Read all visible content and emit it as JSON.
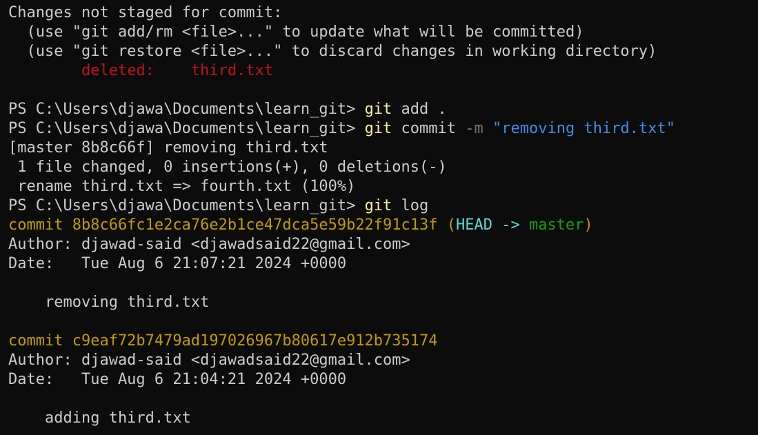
{
  "terminal": {
    "lines": [
      [
        {
          "t": "Changes not staged for commit:",
          "c": "default"
        }
      ],
      [
        {
          "t": "  (use \"git add/rm <file>...\" to update what will be committed)",
          "c": "default"
        }
      ],
      [
        {
          "t": "  (use \"git restore <file>...\" to discard changes in working directory)",
          "c": "default"
        }
      ],
      [
        {
          "t": "        ",
          "c": "default"
        },
        {
          "t": "deleted:    third.txt",
          "c": "red"
        }
      ],
      [
        {
          "t": "",
          "c": "default"
        }
      ],
      [
        {
          "t": "PS C:\\Users\\djawa\\Documents\\learn_git> ",
          "c": "default"
        },
        {
          "t": "git",
          "c": "yellow"
        },
        {
          "t": " add .",
          "c": "default"
        }
      ],
      [
        {
          "t": "PS C:\\Users\\djawa\\Documents\\learn_git> ",
          "c": "default"
        },
        {
          "t": "git",
          "c": "yellow"
        },
        {
          "t": " commit ",
          "c": "default"
        },
        {
          "t": "-m",
          "c": "gray"
        },
        {
          "t": " ",
          "c": "default"
        },
        {
          "t": "\"removing third.txt\"",
          "c": "blue"
        }
      ],
      [
        {
          "t": "[master 8b8c66f] removing third.txt",
          "c": "default"
        }
      ],
      [
        {
          "t": " 1 file changed, 0 insertions(+), 0 deletions(-)",
          "c": "default"
        }
      ],
      [
        {
          "t": " rename third.txt => fourth.txt (100%)",
          "c": "default"
        }
      ],
      [
        {
          "t": "PS C:\\Users\\djawa\\Documents\\learn_git> ",
          "c": "default"
        },
        {
          "t": "git",
          "c": "yellow"
        },
        {
          "t": " log",
          "c": "default"
        }
      ],
      [
        {
          "t": "commit 8b8c66fc1e2ca76e2b1ce47dca5e59b22f91c13f (",
          "c": "gold"
        },
        {
          "t": "HEAD -> ",
          "c": "cyan"
        },
        {
          "t": "master",
          "c": "green"
        },
        {
          "t": ")",
          "c": "gold"
        }
      ],
      [
        {
          "t": "Author: djawad-said <djawadsaid22@gmail.com>",
          "c": "default"
        }
      ],
      [
        {
          "t": "Date:   Tue Aug 6 21:07:21 2024 +0000",
          "c": "default"
        }
      ],
      [
        {
          "t": "",
          "c": "default"
        }
      ],
      [
        {
          "t": "    removing third.txt",
          "c": "default"
        }
      ],
      [
        {
          "t": "",
          "c": "default"
        }
      ],
      [
        {
          "t": "commit c9eaf72b7479ad197026967b80617e912b735174",
          "c": "gold"
        }
      ],
      [
        {
          "t": "Author: djawad-said <djawadsaid22@gmail.com>",
          "c": "default"
        }
      ],
      [
        {
          "t": "Date:   Tue Aug 6 21:04:21 2024 +0000",
          "c": "default"
        }
      ],
      [
        {
          "t": "",
          "c": "default"
        }
      ],
      [
        {
          "t": "    adding third.txt",
          "c": "default"
        }
      ]
    ]
  },
  "colors": {
    "background": "#0c0c0c",
    "default": "#cccccc",
    "red": "#c50f1f",
    "yellow": "#f9f1a5",
    "gray": "#767676",
    "blue": "#3b8eea",
    "gold": "#c19c00",
    "cyan": "#61d6d6",
    "green": "#13a10e"
  }
}
